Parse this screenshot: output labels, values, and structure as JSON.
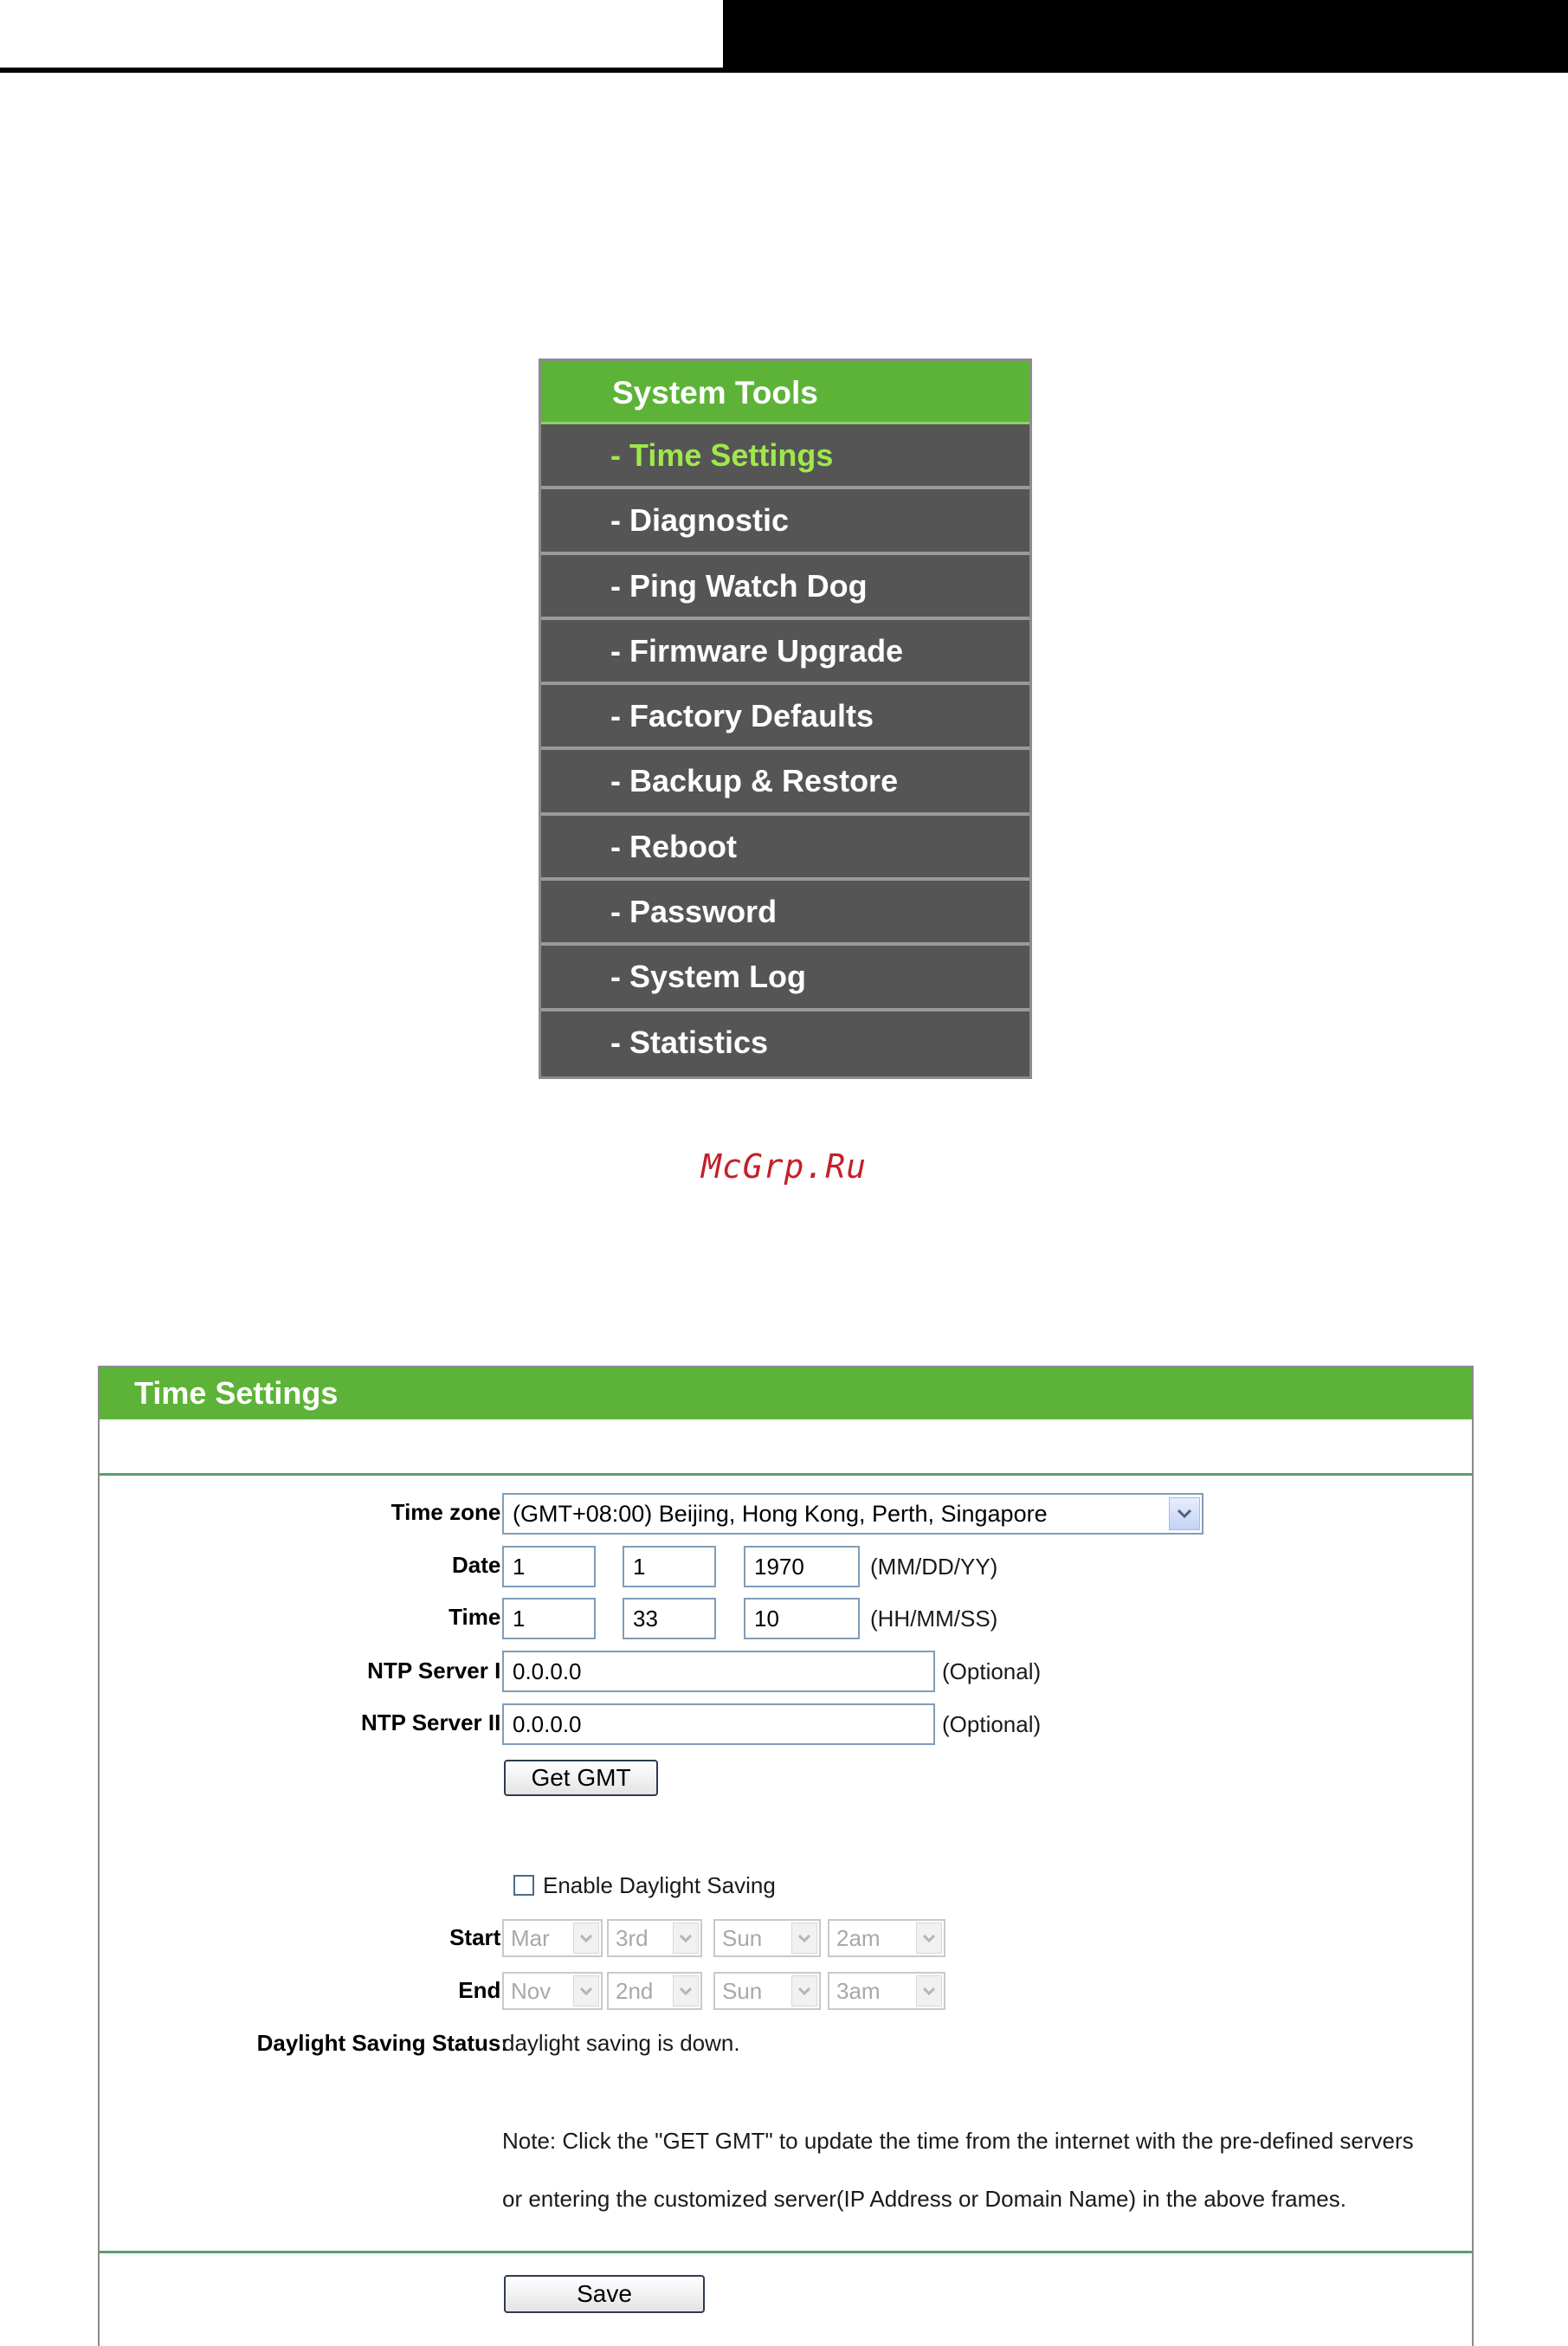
{
  "sidebar": {
    "title": "System Tools",
    "items": [
      {
        "label": "- Time Settings",
        "active": true
      },
      {
        "label": "- Diagnostic"
      },
      {
        "label": "- Ping Watch Dog"
      },
      {
        "label": "- Firmware Upgrade"
      },
      {
        "label": "- Factory Defaults"
      },
      {
        "label": "- Backup & Restore"
      },
      {
        "label": "- Reboot"
      },
      {
        "label": "- Password"
      },
      {
        "label": "- System Log"
      },
      {
        "label": "- Statistics"
      }
    ]
  },
  "watermark": "McGrp.Ru",
  "time_settings": {
    "title": "Time Settings",
    "labels": {
      "time_zone": "Time zone:",
      "date": "Date:",
      "time": "Time:",
      "ntp1": "NTP Server I:",
      "ntp2": "NTP Server II:",
      "start": "Start:",
      "end": "End:",
      "dst_status": "Daylight Saving Status:"
    },
    "time_zone_value": "(GMT+08:00) Beijing, Hong Kong, Perth, Singapore",
    "date": {
      "month": "1",
      "day": "1",
      "year": "1970",
      "hint": "(MM/DD/YY)"
    },
    "time": {
      "hour": "1",
      "minute": "33",
      "second": "10",
      "hint": "(HH/MM/SS)"
    },
    "ntp1_value": "0.0.0.0",
    "ntp2_value": "0.0.0.0",
    "optional": "(Optional)",
    "get_gmt_label": "Get GMT",
    "dst_checkbox_label": "Enable Daylight Saving",
    "dst_enabled": false,
    "start": {
      "month": "Mar",
      "week": "3rd",
      "day": "Sun",
      "hour": "2am"
    },
    "end": {
      "month": "Nov",
      "week": "2nd",
      "day": "Sun",
      "hour": "3am"
    },
    "dst_status_value": "daylight saving is down.",
    "note_line1": "Note: Click the \"GET GMT\" to update the time from the internet with the pre-defined servers",
    "note_line2": "or entering the customized server(IP Address or Domain Name) in the above frames.",
    "save_label": "Save"
  },
  "colors": {
    "accent_green": "#5db338",
    "menu_bg": "#535353",
    "active_item": "#9fe84b",
    "watermark": "#c4202a",
    "separator": "#5aa06a"
  }
}
